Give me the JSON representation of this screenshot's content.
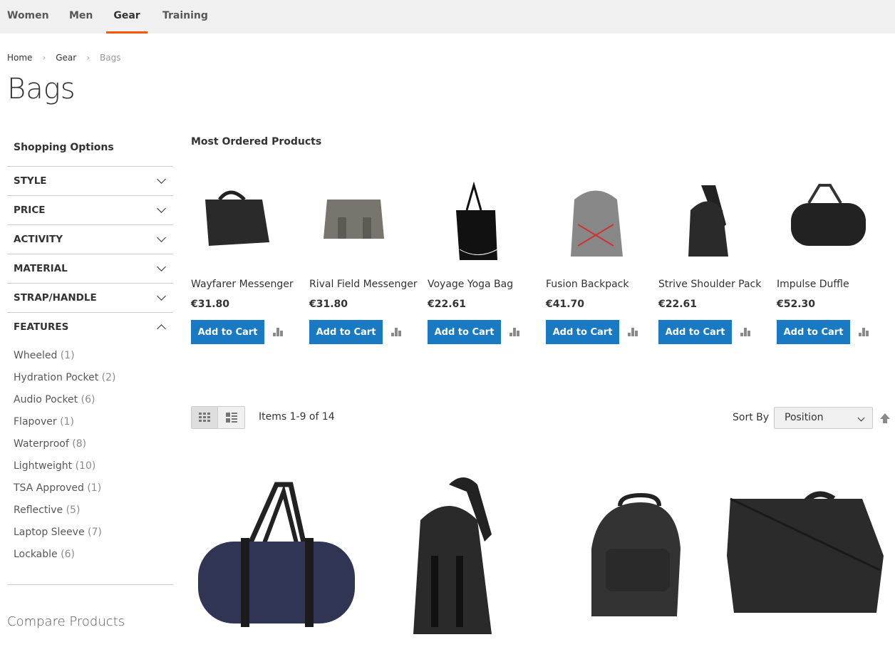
{
  "nav": {
    "items": [
      "Women",
      "Men",
      "Gear",
      "Training"
    ],
    "active": "Gear"
  },
  "breadcrumb": [
    "Home",
    "Gear",
    "Bags"
  ],
  "title": "Bags",
  "sidebar": {
    "heading": "Shopping Options",
    "filters": [
      "STYLE",
      "PRICE",
      "ACTIVITY",
      "MATERIAL",
      "STRAP/HANDLE",
      "FEATURES"
    ],
    "features": [
      {
        "label": "Wheeled",
        "count": "(1)"
      },
      {
        "label": "Hydration Pocket",
        "count": "(2)"
      },
      {
        "label": "Audio Pocket",
        "count": "(6)"
      },
      {
        "label": "Flapover",
        "count": "(1)"
      },
      {
        "label": "Waterproof",
        "count": "(8)"
      },
      {
        "label": "Lightweight",
        "count": "(10)"
      },
      {
        "label": "TSA Approved",
        "count": "(1)"
      },
      {
        "label": "Reflective",
        "count": "(5)"
      },
      {
        "label": "Laptop Sleeve",
        "count": "(7)"
      },
      {
        "label": "Lockable",
        "count": "(6)"
      }
    ],
    "compare": "Compare Products"
  },
  "most_ordered": {
    "heading": "Most Ordered Products",
    "add_label": "Add to Cart",
    "products": [
      {
        "name": "Wayfarer Messenger",
        "price": "€31.80"
      },
      {
        "name": "Rival Field Messenger",
        "price": "€31.80"
      },
      {
        "name": "Voyage Yoga Bag",
        "price": "€22.61"
      },
      {
        "name": "Fusion Backpack",
        "price": "€41.70"
      },
      {
        "name": "Strive Shoulder Pack",
        "price": "€22.61"
      },
      {
        "name": "Impulse Duffle",
        "price": "€52.30"
      }
    ]
  },
  "toolbar": {
    "items": "Items 1-9 of 14",
    "sort_label": "Sort By",
    "sort_value": "Position",
    "view": "grid"
  },
  "colors": {
    "accent": "#ff5501",
    "button": "#1979c3"
  }
}
